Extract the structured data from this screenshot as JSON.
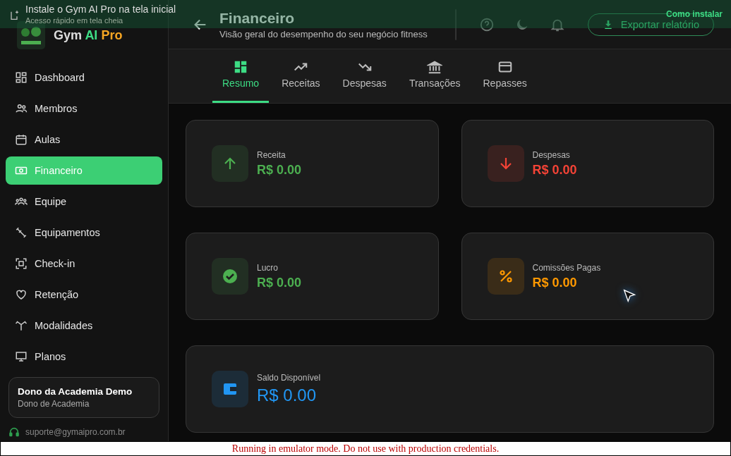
{
  "install_banner": {
    "title": "Instale o Gym AI Pro na tela inicial",
    "subtitle": "Acesso rápido em tela cheia",
    "link": "Como instalar"
  },
  "sidebar": {
    "brand": [
      "Gym",
      "AI",
      "Pro"
    ],
    "items": [
      {
        "label": "Dashboard",
        "selected": false
      },
      {
        "label": "Membros",
        "selected": false
      },
      {
        "label": "Aulas",
        "selected": false
      },
      {
        "label": "Financeiro",
        "selected": true
      },
      {
        "label": "Equipe",
        "selected": false
      },
      {
        "label": "Equipamentos",
        "selected": false
      },
      {
        "label": "Check-in",
        "selected": false
      },
      {
        "label": "Retenção",
        "selected": false
      },
      {
        "label": "Modalidades",
        "selected": false
      },
      {
        "label": "Planos",
        "selected": false
      }
    ],
    "user": {
      "name": "Dono da Academia Demo",
      "role": "Dono de Academia"
    },
    "support": "suporte@gymaipro.com.br"
  },
  "header": {
    "title": "Financeiro",
    "subtitle": "Visão geral do desempenho do seu negócio fitness",
    "export_button": "Exportar relatório"
  },
  "tabs": [
    {
      "label": "Resumo",
      "selected": true
    },
    {
      "label": "Receitas",
      "selected": false
    },
    {
      "label": "Despesas",
      "selected": false
    },
    {
      "label": "Transações",
      "selected": false
    },
    {
      "label": "Repasses",
      "selected": false
    }
  ],
  "stats": [
    {
      "kind": "up",
      "label": "Receita",
      "value": "R$ 0.00",
      "color": "#4caf50"
    },
    {
      "kind": "down",
      "label": "Despesas",
      "value": "R$ 0.00",
      "color": "#f44336"
    },
    {
      "kind": "check",
      "label": "Lucro",
      "value": "R$ 0.00",
      "color": "#4caf50"
    },
    {
      "kind": "percent",
      "label": "Comissões Pagas",
      "value": "R$ 0.00",
      "color": "#ff9800"
    },
    {
      "kind": "wallet",
      "label": "Saldo Disponível",
      "value": "R$ 0.00",
      "color": "#2196f3"
    }
  ],
  "emulator_notice": "Running in emulator mode. Do not use with production credentials."
}
